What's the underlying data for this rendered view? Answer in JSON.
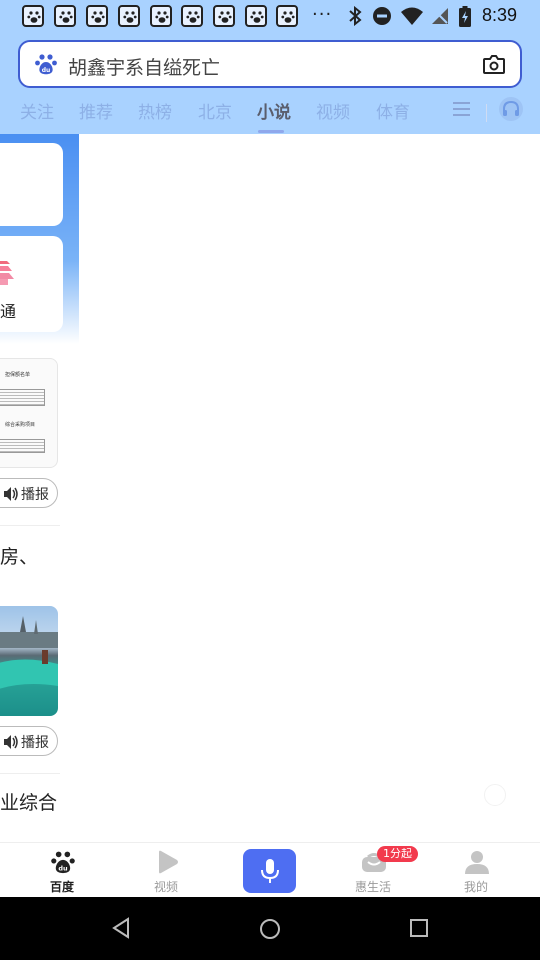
{
  "status_bar": {
    "notification_icon_count": 9,
    "overflow": "···",
    "time": "8:39"
  },
  "search": {
    "query": "胡鑫宇系自缢死亡"
  },
  "tabs": [
    {
      "label": "关注",
      "active": false
    },
    {
      "label": "推荐",
      "active": false
    },
    {
      "label": "热榜",
      "active": false
    },
    {
      "label": "北京",
      "active": false
    },
    {
      "label": "小说",
      "active": true
    },
    {
      "label": "视频",
      "active": false
    },
    {
      "label": "体育",
      "active": false
    }
  ],
  "feed": {
    "card_label": "通",
    "doc_thumb_title": "担保额名单",
    "doc_thumb_subtitle": "综合采购项目",
    "broadcast_label_1": "播报",
    "snippet_1": "房、",
    "broadcast_label_2": "播报",
    "snippet_2": "业综合"
  },
  "bottom_nav": {
    "items": [
      {
        "label": "百度",
        "active": true
      },
      {
        "label": "视频",
        "active": false
      },
      {
        "label": "惠生活",
        "active": false
      },
      {
        "label": "我的",
        "active": false
      }
    ],
    "badge": "1分起"
  },
  "colors": {
    "top_bg": "#a9d2ff",
    "accent": "#4e6ef2",
    "badge": "#f23a4d"
  }
}
